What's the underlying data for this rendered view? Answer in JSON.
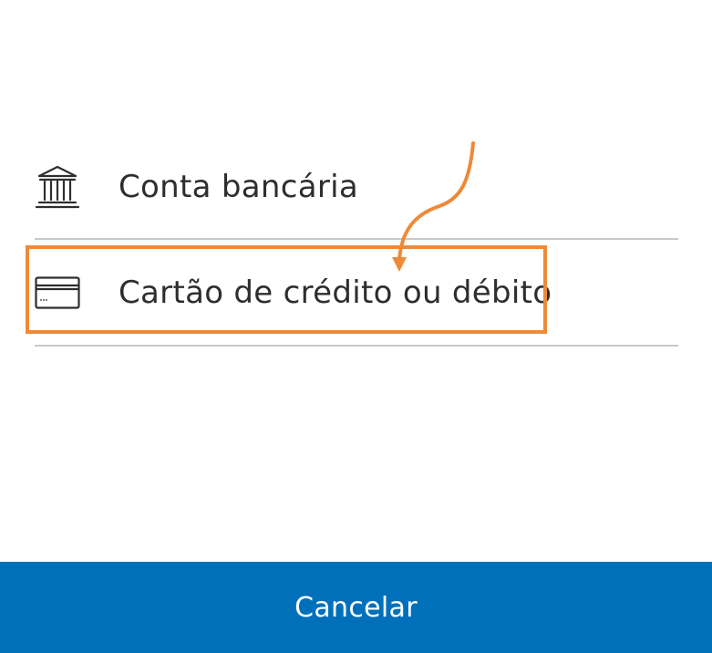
{
  "options": [
    {
      "label": "Conta bancária",
      "icon": "bank-icon"
    },
    {
      "label": "Cartão de crédito ou débito",
      "icon": "credit-card-icon"
    }
  ],
  "annotation": {
    "color": "#ed8a3a",
    "highlighted_option": "Cartão de crédito ou débito"
  },
  "footer": {
    "cancel_label": "Cancelar",
    "background": "#0070ba"
  }
}
